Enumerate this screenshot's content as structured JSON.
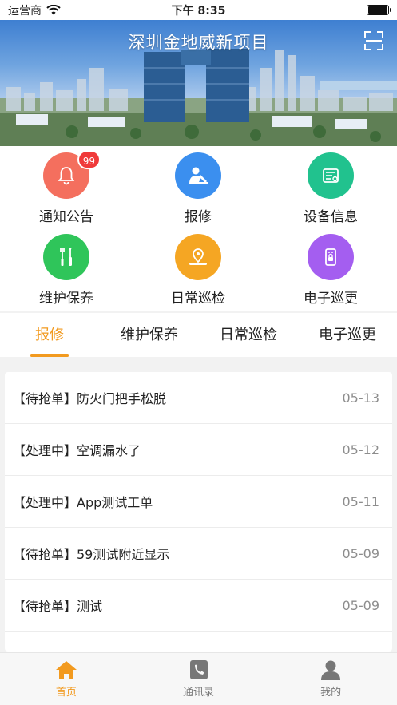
{
  "status_bar": {
    "carrier": "运营商",
    "time": "下午 8:35"
  },
  "banner": {
    "title": "深圳金地威新项目"
  },
  "quick_menu": {
    "items": [
      {
        "label": "通知公告",
        "color": "#f46f5e",
        "icon": "bell-icon",
        "badge": "99"
      },
      {
        "label": "报修",
        "color": "#3b8fef",
        "icon": "repair-person-icon"
      },
      {
        "label": "设备信息",
        "color": "#21c28e",
        "icon": "device-list-icon"
      },
      {
        "label": "维护保养",
        "color": "#2fc55a",
        "icon": "tools-icon"
      },
      {
        "label": "日常巡检",
        "color": "#f5a623",
        "icon": "location-pin-icon"
      },
      {
        "label": "电子巡更",
        "color": "#a45ef0",
        "icon": "patrol-device-icon"
      }
    ]
  },
  "tabs": [
    {
      "label": "报修",
      "active": true
    },
    {
      "label": "维护保养",
      "active": false
    },
    {
      "label": "日常巡检",
      "active": false
    },
    {
      "label": "电子巡更",
      "active": false
    }
  ],
  "work_orders": [
    {
      "title": "【待抢单】防火门把手松脱",
      "date": "05-13"
    },
    {
      "title": "【处理中】空调漏水了",
      "date": "05-12"
    },
    {
      "title": "【处理中】App测试工单",
      "date": "05-11"
    },
    {
      "title": "【待抢单】59测试附近显示",
      "date": "05-09"
    },
    {
      "title": "【待抢单】测试",
      "date": "05-09"
    }
  ],
  "bottom_nav": [
    {
      "label": "首页",
      "icon": "home-icon",
      "active": true
    },
    {
      "label": "通讯录",
      "icon": "phone-book-icon",
      "active": false
    },
    {
      "label": "我的",
      "icon": "profile-icon",
      "active": false
    }
  ],
  "colors": {
    "accent": "#f29a1f",
    "inactive": "#7a7a7a"
  }
}
